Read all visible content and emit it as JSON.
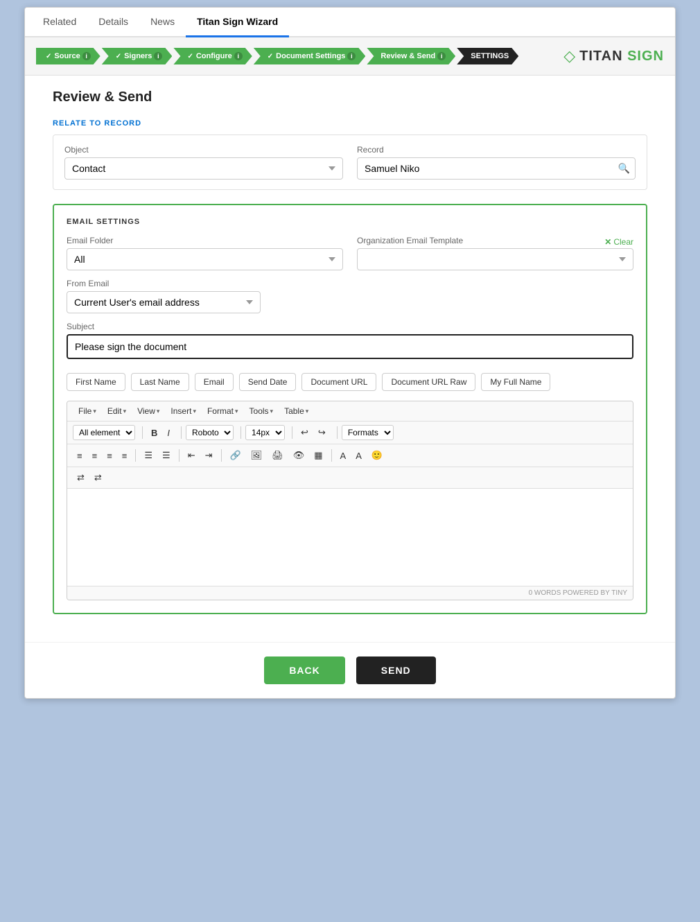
{
  "tabs": [
    {
      "label": "Related",
      "active": false
    },
    {
      "label": "Details",
      "active": false
    },
    {
      "label": "News",
      "active": false
    },
    {
      "label": "Titan Sign Wizard",
      "active": true
    }
  ],
  "wizard": {
    "steps": [
      {
        "label": "Source",
        "done": true,
        "info": true
      },
      {
        "label": "Signers",
        "done": true,
        "info": true
      },
      {
        "label": "Configure",
        "done": true,
        "info": true
      },
      {
        "label": "Document Settings",
        "done": true,
        "info": true
      },
      {
        "label": "Review & Send",
        "done": false,
        "info": true
      },
      {
        "label": "SETTINGS",
        "active": true,
        "info": false
      }
    ],
    "logo_diamond": "◇",
    "logo_prefix": "TITAN ",
    "logo_suffix": "SIGN"
  },
  "page_title": "Review & Send",
  "relate_section": {
    "title": "RELATE TO RECORD",
    "object_label": "Object",
    "object_value": "Contact",
    "record_label": "Record",
    "record_value": "Samuel Niko"
  },
  "email_settings": {
    "title": "EMAIL SETTINGS",
    "email_folder_label": "Email Folder",
    "email_folder_value": "All",
    "org_template_label": "Organization Email Template",
    "clear_label": "Clear",
    "from_email_label": "From Email",
    "from_email_value": "Current User's email address",
    "subject_label": "Subject",
    "subject_value": "Please sign the document",
    "tokens": [
      {
        "label": "First Name"
      },
      {
        "label": "Last Name"
      },
      {
        "label": "Email"
      },
      {
        "label": "Send Date"
      },
      {
        "label": "Document URL"
      },
      {
        "label": "Document URL Raw"
      },
      {
        "label": "My Full Name"
      }
    ]
  },
  "editor": {
    "menu_items": [
      {
        "label": "File"
      },
      {
        "label": "Edit"
      },
      {
        "label": "View"
      },
      {
        "label": "Insert"
      },
      {
        "label": "Format"
      },
      {
        "label": "Tools"
      },
      {
        "label": "Table"
      }
    ],
    "font_selector": "All element",
    "font_name": "Roboto",
    "font_size": "14px",
    "formats_label": "Formats",
    "word_count": "0 WORDS POWERED BY TINY"
  },
  "buttons": {
    "back": "BACK",
    "send": "SEND"
  }
}
